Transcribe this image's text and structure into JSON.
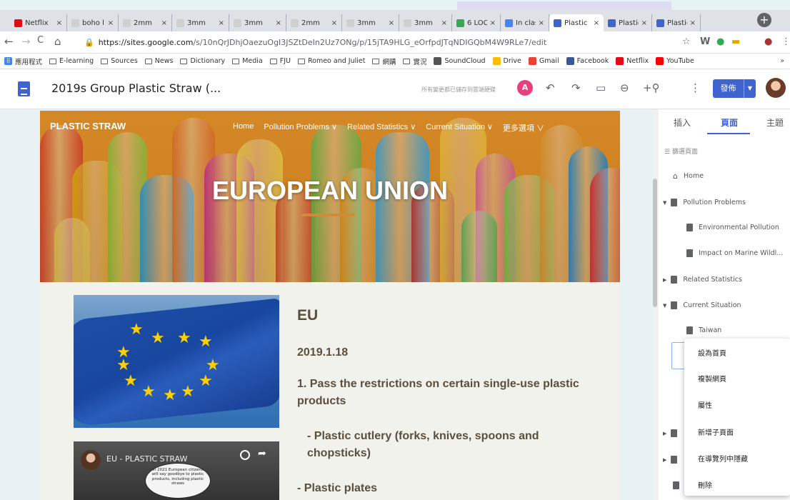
{
  "browser": {
    "tabs": [
      {
        "label": "Netflix",
        "color": "#e50914"
      },
      {
        "label": "boho l",
        "color": "#d0d0d0"
      },
      {
        "label": "2mm",
        "color": "#d0d0d0"
      },
      {
        "label": "3mm",
        "color": "#d0d0d0"
      },
      {
        "label": "3mm",
        "color": "#d0d0d0"
      },
      {
        "label": "2mm",
        "color": "#d0d0d0"
      },
      {
        "label": "3mm",
        "color": "#d0d0d0"
      },
      {
        "label": "3mm",
        "color": "#d0d0d0"
      },
      {
        "label": "6 LOC",
        "color": "#34a853"
      },
      {
        "label": "In clas",
        "color": "#4285f4"
      },
      {
        "label": "Plastic",
        "color": "#3f64cf"
      },
      {
        "label": "Plastic",
        "color": "#3f64cf"
      },
      {
        "label": "Plastic",
        "color": "#3f64cf"
      }
    ],
    "active_tab": 10,
    "url_host": "https://sites.google.com",
    "url_path": "/s/10nQrJDhjOaezuOgI3JSZtDeIn2Uz7ONg/p/15jTA9HLG_eOrfpdJTqNDIGQbM4W9RLe7/edit",
    "bookmarks": [
      {
        "label": "應用程式",
        "kind": "apps"
      },
      {
        "label": "E-learning",
        "kind": "folder"
      },
      {
        "label": "Sources",
        "kind": "folder"
      },
      {
        "label": "News",
        "kind": "folder"
      },
      {
        "label": "Dictionary",
        "kind": "folder"
      },
      {
        "label": "Media",
        "kind": "folder"
      },
      {
        "label": "FJU",
        "kind": "folder"
      },
      {
        "label": "Romeo and Juliet",
        "kind": "folder"
      },
      {
        "label": "網購",
        "kind": "folder"
      },
      {
        "label": "實況",
        "kind": "folder"
      },
      {
        "label": "SoundCloud",
        "kind": "site",
        "color": "#555555"
      },
      {
        "label": "Drive",
        "kind": "site",
        "color": "#fbbc04"
      },
      {
        "label": "Gmail",
        "kind": "site",
        "color": "#ea4335"
      },
      {
        "label": "Facebook",
        "kind": "site",
        "color": "#3b5998"
      },
      {
        "label": "Netflix",
        "kind": "site",
        "color": "#e50914"
      },
      {
        "label": "YouTube",
        "kind": "site",
        "color": "#ff0000"
      }
    ],
    "bookmarks_more": "»"
  },
  "editor": {
    "site_title": "2019s Group Plastic Straw (...",
    "save_status": "所有變更都已儲存到雲端硬碟",
    "avatar_letter": "A",
    "publish_label": "發佈",
    "colors": {
      "accent": "#3f64cf",
      "avatar": "#e8407f"
    }
  },
  "site": {
    "brand": "PLASTIC STRAW",
    "nav": [
      "Home",
      "Pollution Problems ∨",
      "Related Statistics ∨",
      "Current Situation ∨",
      "更多選項 ∨"
    ],
    "hero_title": "EUROPEAN UNION"
  },
  "content": {
    "heading": "EU",
    "date": "2019.1.18",
    "point1": "1. Pass the restrictions on certain single-use plastic products",
    "point2": "- Plastic cutlery (forks, knives, spoons and chopsticks)",
    "point3": "- Plastic plates",
    "video": {
      "title": "EU - PLASTIC STRAW",
      "note": "In 2021 European citizens will say goodbye to plastic products, including plastic straws"
    }
  },
  "panel": {
    "tabs": [
      "插入",
      "頁面",
      "主題"
    ],
    "active": 1,
    "filter_placeholder": "篩選頁面",
    "pages": {
      "home": "Home",
      "pollution": "Pollution Problems",
      "env": "Environmental Pollution",
      "marine": "Impact on Marine Wildl...",
      "stats": "Related Statistics",
      "current": "Current Situation",
      "taiwan": "Taiwan"
    },
    "context_menu": [
      "設為首頁",
      "複製網頁",
      "屬性",
      "新增子頁面",
      "在導覽列中隱藏",
      "刪除"
    ]
  }
}
